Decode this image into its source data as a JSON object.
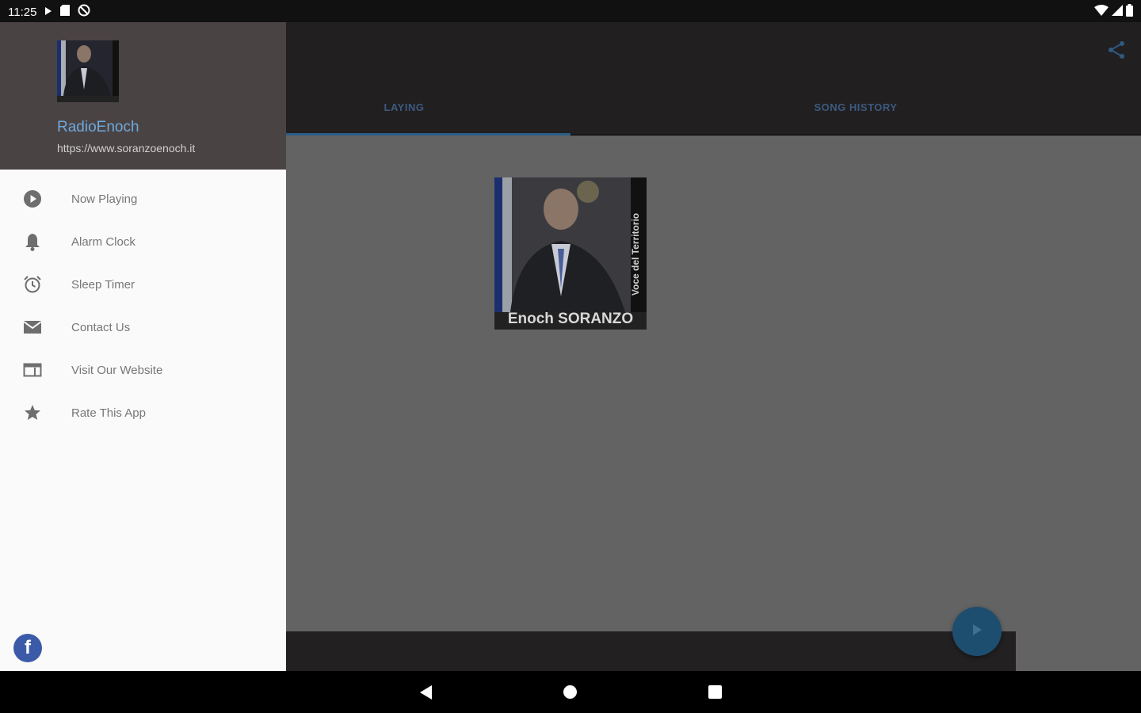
{
  "status": {
    "time": "11:25"
  },
  "tabs": [
    {
      "label": "LAYING"
    },
    {
      "label": "SONG HISTORY"
    }
  ],
  "album": {
    "caption": "Enoch SORANZO",
    "vertical_text": "Voce del Territorio"
  },
  "drawer": {
    "title": "RadioEnoch",
    "url": "https://www.soranzoenoch.it",
    "items": [
      {
        "label": "Now Playing",
        "icon": "play-circle-icon"
      },
      {
        "label": "Alarm Clock",
        "icon": "bell-icon"
      },
      {
        "label": "Sleep Timer",
        "icon": "alarm-clock-icon"
      },
      {
        "label": "Contact Us",
        "icon": "mail-icon"
      },
      {
        "label": "Visit Our Website",
        "icon": "web-icon"
      },
      {
        "label": "Rate This App",
        "icon": "star-icon"
      }
    ],
    "facebook": "f"
  },
  "colors": {
    "accent": "#6fa8dc",
    "header": "#4a4344",
    "fab": "#1d4e6f"
  }
}
